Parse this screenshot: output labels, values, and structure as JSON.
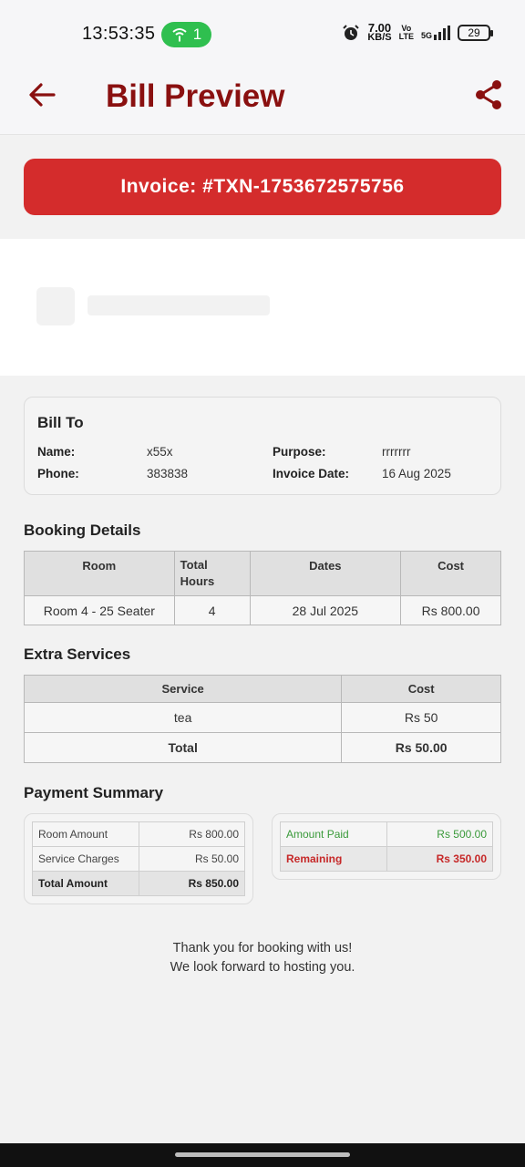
{
  "status_bar": {
    "time": "13:53:35",
    "hotspot_count": "1",
    "net_speed_value": "7.00",
    "net_speed_unit": "KB/S",
    "volte_top": "Vo",
    "volte_bottom": "LTE",
    "network": "5G",
    "battery": "29"
  },
  "app_bar": {
    "title": "Bill Preview",
    "back_icon": "arrow-left-icon",
    "share_icon": "share-icon"
  },
  "invoice": {
    "label": "Invoice: #TXN-1753672575756"
  },
  "bill_to": {
    "heading": "Bill To",
    "name_label": "Name:",
    "name_value": "x55x",
    "phone_label": "Phone:",
    "phone_value": "383838",
    "purpose_label": "Purpose:",
    "purpose_value": "rrrrrrr",
    "invoice_date_label": "Invoice Date:",
    "invoice_date_value": "16 Aug 2025"
  },
  "booking_details": {
    "title": "Booking Details",
    "headers": [
      "Room",
      "Total Hours",
      "Dates",
      "Cost"
    ],
    "rows": [
      [
        "Room 4 - 25 Seater",
        "4",
        "28 Jul 2025",
        "Rs 800.00"
      ]
    ]
  },
  "extra_services": {
    "title": "Extra Services",
    "headers": [
      "Service",
      "Cost"
    ],
    "rows": [
      [
        "tea",
        "Rs 50"
      ]
    ],
    "total_label": "Total",
    "total_value": "Rs 50.00"
  },
  "payment_summary": {
    "title": "Payment Summary",
    "room_amount_label": "Room Amount",
    "room_amount_value": "Rs 800.00",
    "service_charges_label": "Service Charges",
    "service_charges_value": "Rs 50.00",
    "total_amount_label": "Total Amount",
    "total_amount_value": "Rs 850.00",
    "amount_paid_label": "Amount Paid",
    "amount_paid_value": "Rs 500.00",
    "remaining_label": "Remaining",
    "remaining_value": "Rs 350.00"
  },
  "footer": {
    "line1": "Thank you for booking with us!",
    "line2": "We look forward to hosting you."
  },
  "colors": {
    "brand_dark_red": "#8a1010",
    "banner_red": "#d42c2c",
    "paid_green": "#3a9a3a",
    "remaining_red": "#c62828"
  }
}
